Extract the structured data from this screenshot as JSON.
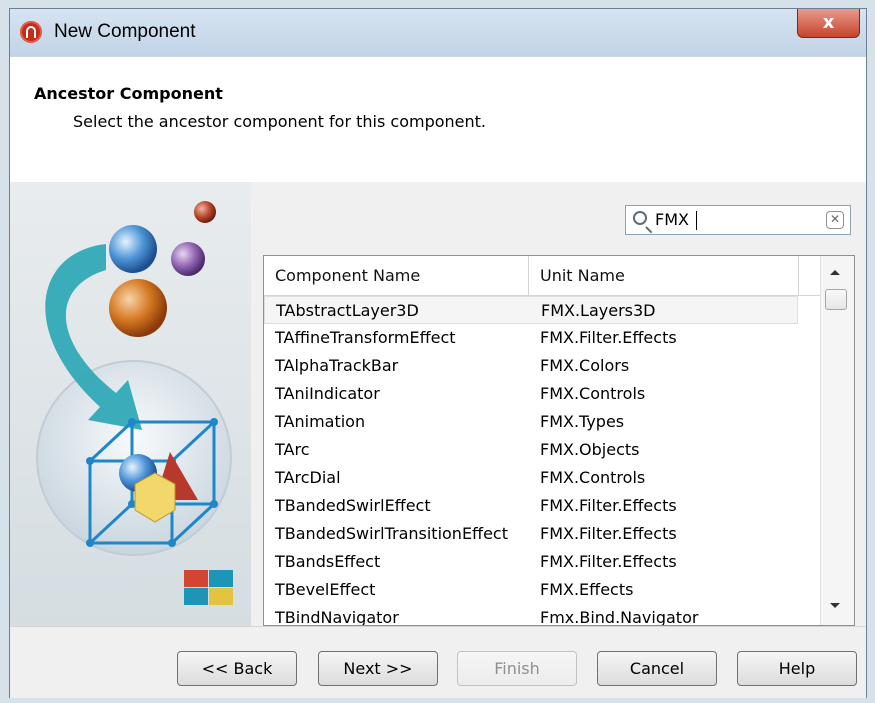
{
  "window": {
    "title": "New Component",
    "close_label": "x"
  },
  "header": {
    "title": "Ancestor Component",
    "subtitle": "Select the ancestor component for this component."
  },
  "search": {
    "value": "FMX",
    "placeholder": ""
  },
  "table": {
    "columns": [
      "Component Name",
      "Unit Name"
    ],
    "rows": [
      [
        "TAbstractLayer3D",
        "FMX.Layers3D"
      ],
      [
        "TAffineTransformEffect",
        "FMX.Filter.Effects"
      ],
      [
        "TAlphaTrackBar",
        "FMX.Colors"
      ],
      [
        "TAniIndicator",
        "FMX.Controls"
      ],
      [
        "TAnimation",
        "FMX.Types"
      ],
      [
        "TArc",
        "FMX.Objects"
      ],
      [
        "TArcDial",
        "FMX.Controls"
      ],
      [
        "TBandedSwirlEffect",
        "FMX.Filter.Effects"
      ],
      [
        "TBandedSwirlTransitionEffect",
        "FMX.Filter.Effects"
      ],
      [
        "TBandsEffect",
        "FMX.Filter.Effects"
      ],
      [
        "TBevelEffect",
        "FMX.Effects"
      ],
      [
        "TBindNavigator",
        "Fmx.Bind.Navigator"
      ]
    ]
  },
  "buttons": {
    "back": "<< Back",
    "next": "Next >>",
    "finish": "Finish",
    "cancel": "Cancel",
    "help": "Help"
  }
}
